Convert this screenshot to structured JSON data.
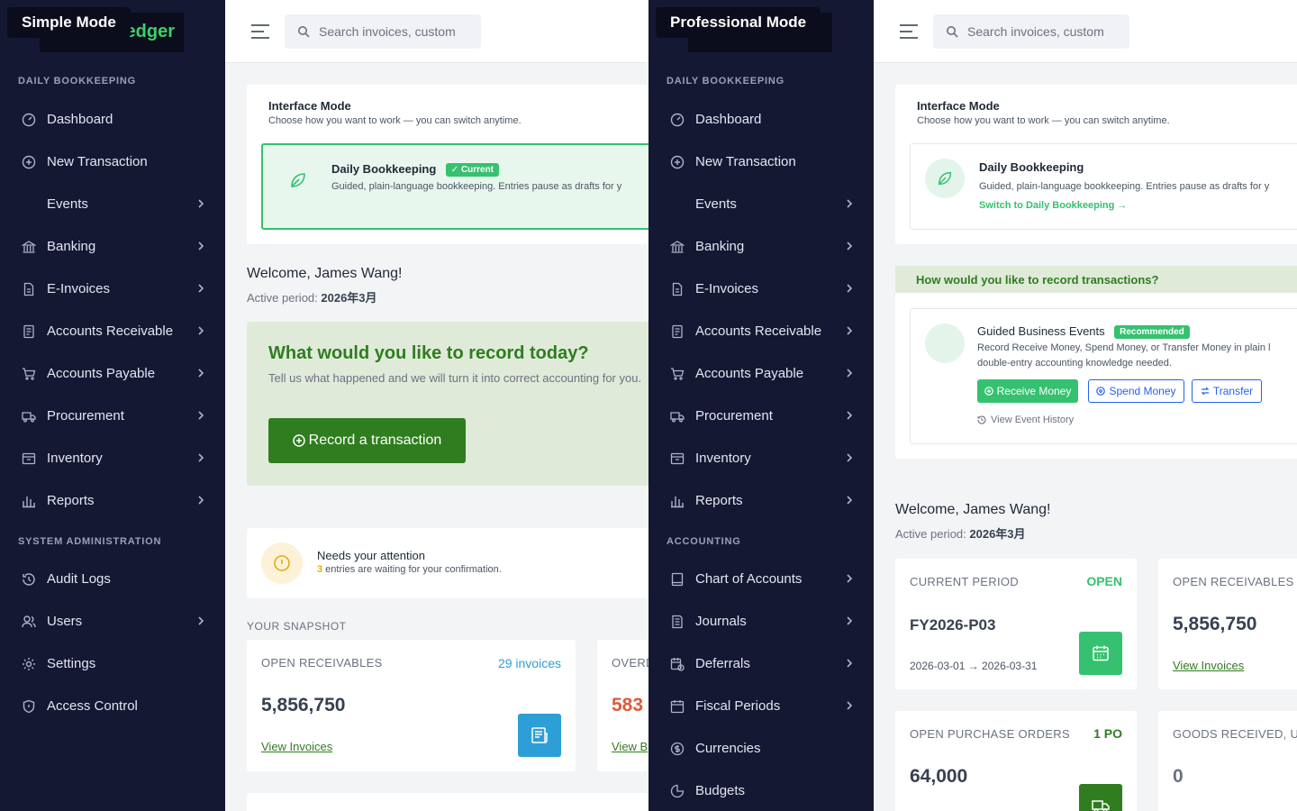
{
  "simple": {
    "mode_label": "Simple Mode",
    "logo_text": "edger",
    "search_placeholder": "Search invoices, custom",
    "nav_sections": [
      {
        "title": "DAILY BOOKKEEPING"
      },
      {
        "title": "SYSTEM ADMINISTRATION"
      }
    ],
    "nav_items": [
      {
        "label": "Dashboard"
      },
      {
        "label": "New Transaction"
      },
      {
        "label": "Events"
      },
      {
        "label": "Banking"
      },
      {
        "label": "E-Invoices"
      },
      {
        "label": "Accounts Receivable"
      },
      {
        "label": "Accounts Payable"
      },
      {
        "label": "Procurement"
      },
      {
        "label": "Inventory"
      },
      {
        "label": "Reports"
      },
      {
        "label": "Audit Logs"
      },
      {
        "label": "Users"
      },
      {
        "label": "Settings"
      },
      {
        "label": "Access Control"
      }
    ],
    "interface_mode": {
      "title": "Interface Mode",
      "subtitle": "Choose how you want to work — you can switch anytime.",
      "option_title": "Daily Bookkeeping",
      "option_badge": "Current",
      "option_desc": "Guided, plain-language bookkeeping. Entries pause as drafts for y"
    },
    "welcome": "Welcome, James Wang!",
    "active_period_label": "Active period:",
    "active_period_value": "2026年3月",
    "record_panel": {
      "title": "What would you like to record today?",
      "desc": "Tell us what happened and we will turn it into correct accounting for you.",
      "button": "Record a transaction"
    },
    "attention": {
      "title": "Needs your attention",
      "count": "3",
      "text": " entries are waiting for your confirmation."
    },
    "snapshot_title": "YOUR SNAPSHOT",
    "snapshot": [
      {
        "title": "OPEN RECEIVABLES",
        "meta": "29 invoices",
        "value": "5,856,750",
        "link": "View Invoices"
      },
      {
        "title": "OVERD",
        "value": "583",
        "link": "View B"
      }
    ]
  },
  "pro": {
    "mode_label": "Professional Mode",
    "search_placeholder": "Search invoices, custom",
    "nav_sections": [
      {
        "title": "DAILY BOOKKEEPING"
      },
      {
        "title": "ACCOUNTING"
      }
    ],
    "nav_items": [
      {
        "label": "Dashboard"
      },
      {
        "label": "New Transaction"
      },
      {
        "label": "Events"
      },
      {
        "label": "Banking"
      },
      {
        "label": "E-Invoices"
      },
      {
        "label": "Accounts Receivable"
      },
      {
        "label": "Accounts Payable"
      },
      {
        "label": "Procurement"
      },
      {
        "label": "Inventory"
      },
      {
        "label": "Reports"
      },
      {
        "label": "Chart of Accounts"
      },
      {
        "label": "Journals"
      },
      {
        "label": "Deferrals"
      },
      {
        "label": "Fiscal Periods"
      },
      {
        "label": "Currencies"
      },
      {
        "label": "Budgets"
      }
    ],
    "interface_mode": {
      "title": "Interface Mode",
      "subtitle": "Choose how you want to work — you can switch anytime.",
      "option_title": "Daily Bookkeeping",
      "option_desc": "Guided, plain-language bookkeeping. Entries pause as drafts for y",
      "switch_link": "Switch to Daily Bookkeeping →"
    },
    "record_question": "How would you like to record transactions?",
    "guided": {
      "title": "Guided Business Events",
      "badge": "Recommended",
      "desc1": "Record Receive Money, Spend Money, or Transfer Money in plain l",
      "desc2": "double-entry accounting knowledge needed.",
      "btn_receive": "Receive Money",
      "btn_spend": "Spend Money",
      "btn_transfer": "Transfer",
      "history": "View Event History"
    },
    "welcome": "Welcome, James Wang!",
    "active_period_label": "Active period:",
    "active_period_value": "2026年3月",
    "stats": [
      {
        "title": "CURRENT PERIOD",
        "meta": "OPEN",
        "value": "FY2026-P03",
        "range": "2026-03-01 → 2026-03-31"
      },
      {
        "title": "OPEN RECEIVABLES",
        "value": "5,856,750",
        "link": "View Invoices"
      },
      {
        "title": "OPEN PURCHASE ORDERS",
        "meta": "1 PO",
        "value": "64,000"
      },
      {
        "title": "GOODS RECEIVED, UN",
        "value": "0"
      }
    ]
  },
  "colors": {
    "sidebar_bg": "#151833",
    "brand_green": "#2f7d1f",
    "accent_green": "#35c16f",
    "info_blue": "#2e9ed6",
    "danger": "#e05a3a"
  }
}
